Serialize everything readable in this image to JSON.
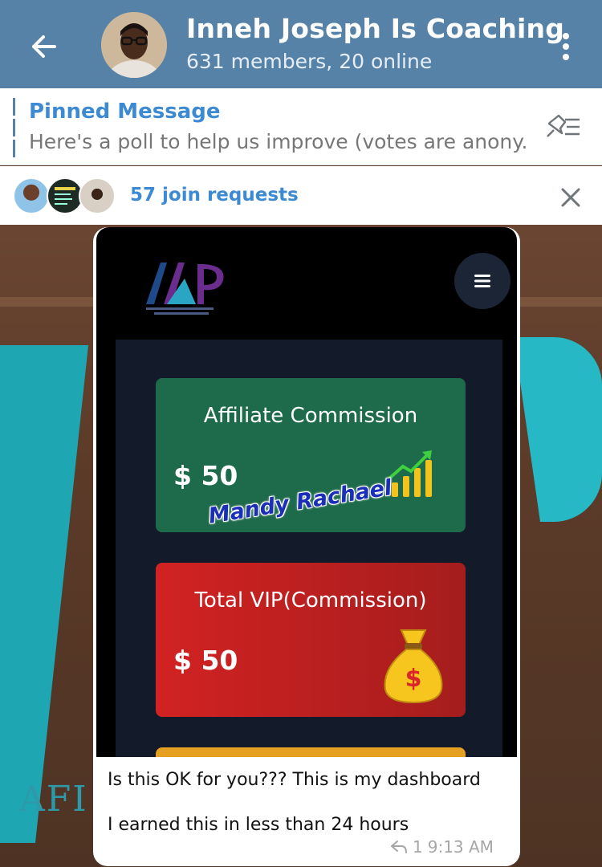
{
  "header": {
    "title": "Inneh Joseph Is Coaching",
    "subtitle": "631 members, 20 online",
    "back_icon": "arrow-left-icon",
    "menu_icon": "more-vertical-icon"
  },
  "pinned": {
    "title": "Pinned Message",
    "text": "Here's a poll to help us improve (votes are anony...",
    "icon": "pinned-list-icon"
  },
  "join_requests": {
    "text": "57 join requests",
    "close_icon": "close-icon"
  },
  "message": {
    "screenshot": {
      "cards": [
        {
          "title": "Affiliate Commission",
          "amount": "$ 50",
          "icon": "growth-chart-icon",
          "color": "#1d6b4a"
        },
        {
          "title": "Total VIP(Commission)",
          "amount": "$ 50",
          "icon": "money-bag-icon",
          "color": "#c21f1f"
        }
      ],
      "watermark": "Mandy Rachael",
      "menu_icon": "hamburger-icon"
    },
    "text_line1": "Is this OK for you??? This is my dashboard",
    "text_line2": "I earned this in less than 24 hours",
    "replies": "1",
    "time": "9:13 AM"
  },
  "colors": {
    "header": "#5682a8",
    "link": "#3c8ad2"
  }
}
